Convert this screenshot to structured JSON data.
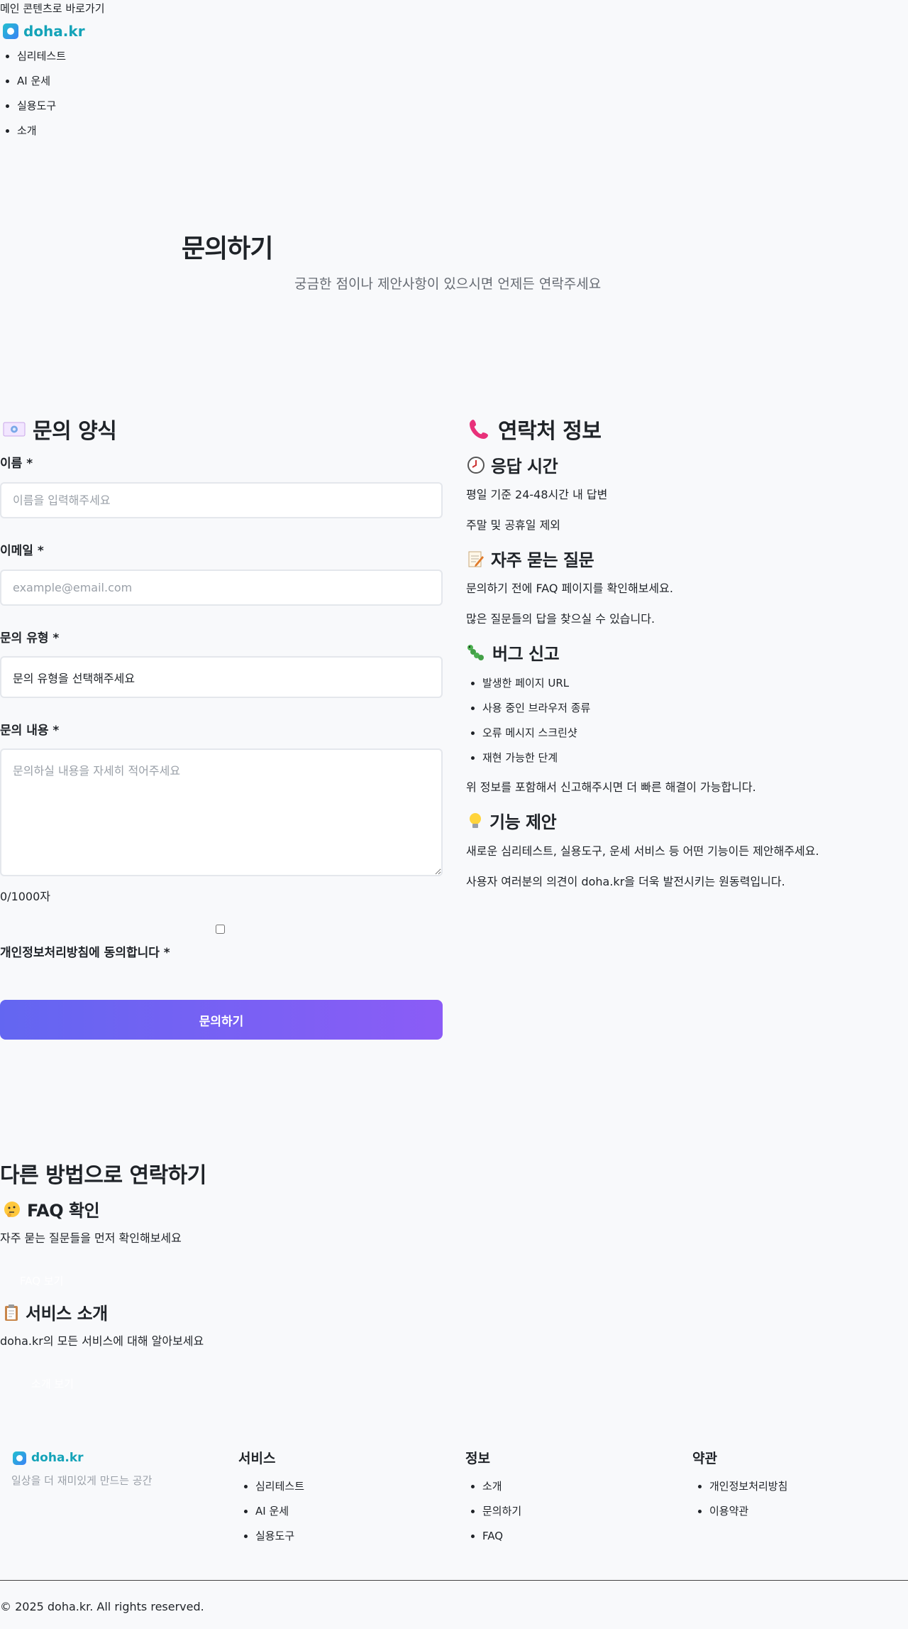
{
  "skip_link": "메인 콘텐츠로 바로가기",
  "header": {
    "logo": "doha.kr",
    "nav": [
      "심리테스트",
      "AI 운세",
      "실용도구",
      "소개"
    ]
  },
  "hero": {
    "title": "문의하기",
    "subtitle": "궁금한 점이나 제안사항이 있으시면 언제든 연락주세요"
  },
  "form": {
    "heading": "문의 양식",
    "name_label": "이름 *",
    "name_placeholder": "이름을 입력해주세요",
    "email_label": "이메일 *",
    "email_placeholder": "example@email.com",
    "type_label": "문의 유형 *",
    "type_value": "문의 유형을 선택해주세요",
    "content_label": "문의 내용 *",
    "content_placeholder": "문의하실 내용을 자세히 적어주세요",
    "char_count": "0/1000자",
    "agree_label": "개인정보처리방침에 동의합니다 *",
    "submit_label": "문의하기"
  },
  "contact": {
    "heading": "연락처 정보",
    "response_heading": "응답 시간",
    "response_lines": [
      "평일 기준 24-48시간 내 답변",
      "주말 및 공휴일 제외"
    ],
    "faq_heading": "자주 묻는 질문",
    "faq_lines": [
      "문의하기 전에 FAQ 페이지를 확인해보세요.",
      "많은 질문들의 답을 찾으실 수 있습니다."
    ],
    "bug_heading": "버그 신고",
    "bug_items": [
      "발생한 페이지 URL",
      "사용 중인 브라우저 종류",
      "오류 메시지 스크린샷",
      "재현 가능한 단계"
    ],
    "bug_note": "위 정보를 포함해서 신고해주시면 더 빠른 해결이 가능합니다.",
    "feature_heading": "기능 제안",
    "feature_lines": [
      "새로운 심리테스트, 실용도구, 운세 서비스 등 어떤 기능이든 제안해주세요.",
      "사용자 여러분의 의견이 doha.kr을 더욱 발전시키는 원동력입니다."
    ]
  },
  "other": {
    "heading": "다른 방법으로 연락하기",
    "faq_title": "FAQ 확인",
    "faq_desc": "자주 묻는 질문들을 먼저 확인해보세요",
    "faq_button": "FAQ 보기",
    "about_title": "서비스 소개",
    "about_desc": "doha.kr의 모든 서비스에 대해 알아보세요",
    "about_button": "소개 보기"
  },
  "footer": {
    "logo": "doha.kr",
    "tagline": "일상을 더 재미있게 만드는 공간",
    "services_title": "서비스",
    "services": [
      "심리테스트",
      "AI 운세",
      "실용도구"
    ],
    "info_title": "정보",
    "info": [
      "소개",
      "문의하기",
      "FAQ"
    ],
    "terms_title": "약관",
    "terms": [
      "개인정보처리방침",
      "이용약관"
    ],
    "copyright": "© 2025 doha.kr. All rights reserved."
  }
}
